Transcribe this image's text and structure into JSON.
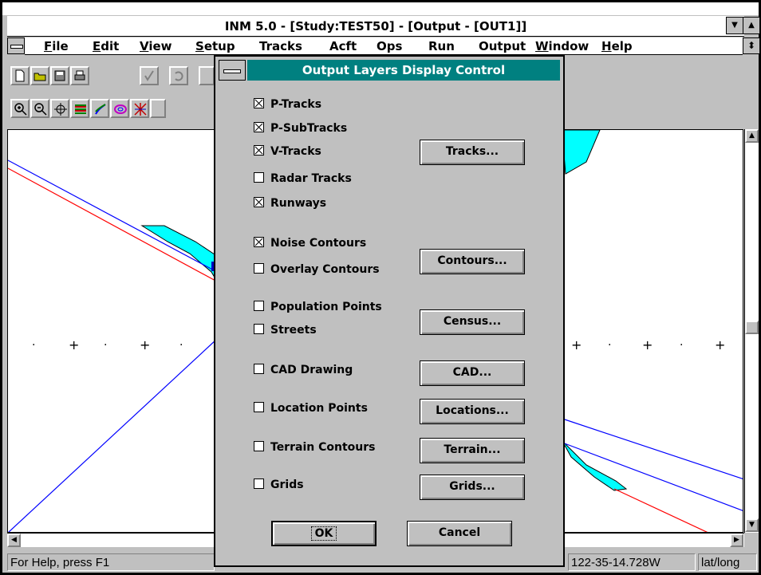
{
  "window": {
    "title": "INM 5.0 - [Study:TEST50] - [Output - [OUT1]]"
  },
  "menu": [
    {
      "label": "File"
    },
    {
      "label": "Edit"
    },
    {
      "label": "View"
    },
    {
      "label": "Setup"
    },
    {
      "label": "Tracks"
    },
    {
      "label": "Acft"
    },
    {
      "label": "Ops"
    },
    {
      "label": "Run"
    },
    {
      "label": "Output"
    },
    {
      "label": "Window"
    },
    {
      "label": "Help"
    }
  ],
  "toolbar1": [
    "new-file-icon",
    "open-folder-icon",
    "save-disk-icon",
    "printer-icon",
    "check-icon",
    "undo-icon"
  ],
  "toolbar2": [
    "zoom-in-icon",
    "zoom-out-icon",
    "crosshair-icon",
    "layers-icon",
    "tracks-icon",
    "contour-icon",
    "grid-icon"
  ],
  "dialog": {
    "title": "Output Layers Display Control",
    "checkboxes": [
      {
        "label": "P-Tracks",
        "checked": true
      },
      {
        "label": "P-SubTracks",
        "checked": true
      },
      {
        "label": "V-Tracks",
        "checked": true
      },
      {
        "label": "Radar Tracks",
        "checked": false
      },
      {
        "label": "Runways",
        "checked": true
      },
      {
        "label": "Noise Contours",
        "checked": true
      },
      {
        "label": "Overlay Contours",
        "checked": false
      },
      {
        "label": "Population Points",
        "checked": false
      },
      {
        "label": "Streets",
        "checked": false
      },
      {
        "label": "CAD Drawing",
        "checked": false
      },
      {
        "label": "Location Points",
        "checked": false
      },
      {
        "label": "Terrain Contours",
        "checked": false
      },
      {
        "label": "Grids",
        "checked": false
      }
    ],
    "buttons": {
      "tracks": "Tracks...",
      "contours": "Contours...",
      "census": "Census...",
      "cad": "CAD...",
      "locations": "Locations...",
      "terrain": "Terrain...",
      "grids": "Grids...",
      "ok": "OK",
      "cancel": "Cancel"
    }
  },
  "canvas": {
    "grid_marker": "+",
    "grid_dot": "·"
  },
  "status": {
    "help": "For Help, press F1",
    "coordinate": "122-35-14.728W",
    "coord_mode": "lat/long"
  },
  "colors": {
    "contour_fill": "#00ffff",
    "track_blue": "#0000ff",
    "track_red": "#ff0000",
    "dialog_title_bg": "#008080"
  }
}
